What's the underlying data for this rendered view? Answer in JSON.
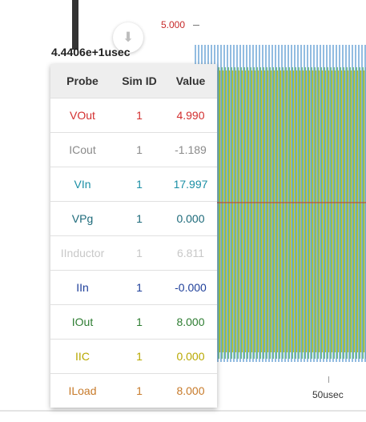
{
  "header": {
    "time_label": "4.4406e+1usec",
    "download_icon": "download-icon"
  },
  "axes": {
    "y_top_label": "5.000",
    "x_label": "50usec"
  },
  "table": {
    "columns": [
      "Probe",
      "Sim ID",
      "Value"
    ],
    "rows": [
      {
        "probe": "VOut",
        "sim_id": "1",
        "value": "4.990",
        "color": "#d32f2f"
      },
      {
        "probe": "ICout",
        "sim_id": "1",
        "value": "-1.189",
        "color": "#8a8a8a"
      },
      {
        "probe": "VIn",
        "sim_id": "1",
        "value": "17.997",
        "color": "#1a8fa5"
      },
      {
        "probe": "VPg",
        "sim_id": "1",
        "value": "0.000",
        "color": "#1d6a7a"
      },
      {
        "probe": "IInductor",
        "sim_id": "1",
        "value": "6.811",
        "color": "#c8c8c8"
      },
      {
        "probe": "IIn",
        "sim_id": "1",
        "value": "-0.000",
        "color": "#1e3f9a"
      },
      {
        "probe": "IOut",
        "sim_id": "1",
        "value": "8.000",
        "color": "#2e7d32"
      },
      {
        "probe": "IIC",
        "sim_id": "1",
        "value": "0.000",
        "color": "#b8a800"
      },
      {
        "probe": "ILoad",
        "sim_id": "1",
        "value": "8.000",
        "color": "#c77a2a"
      }
    ]
  }
}
